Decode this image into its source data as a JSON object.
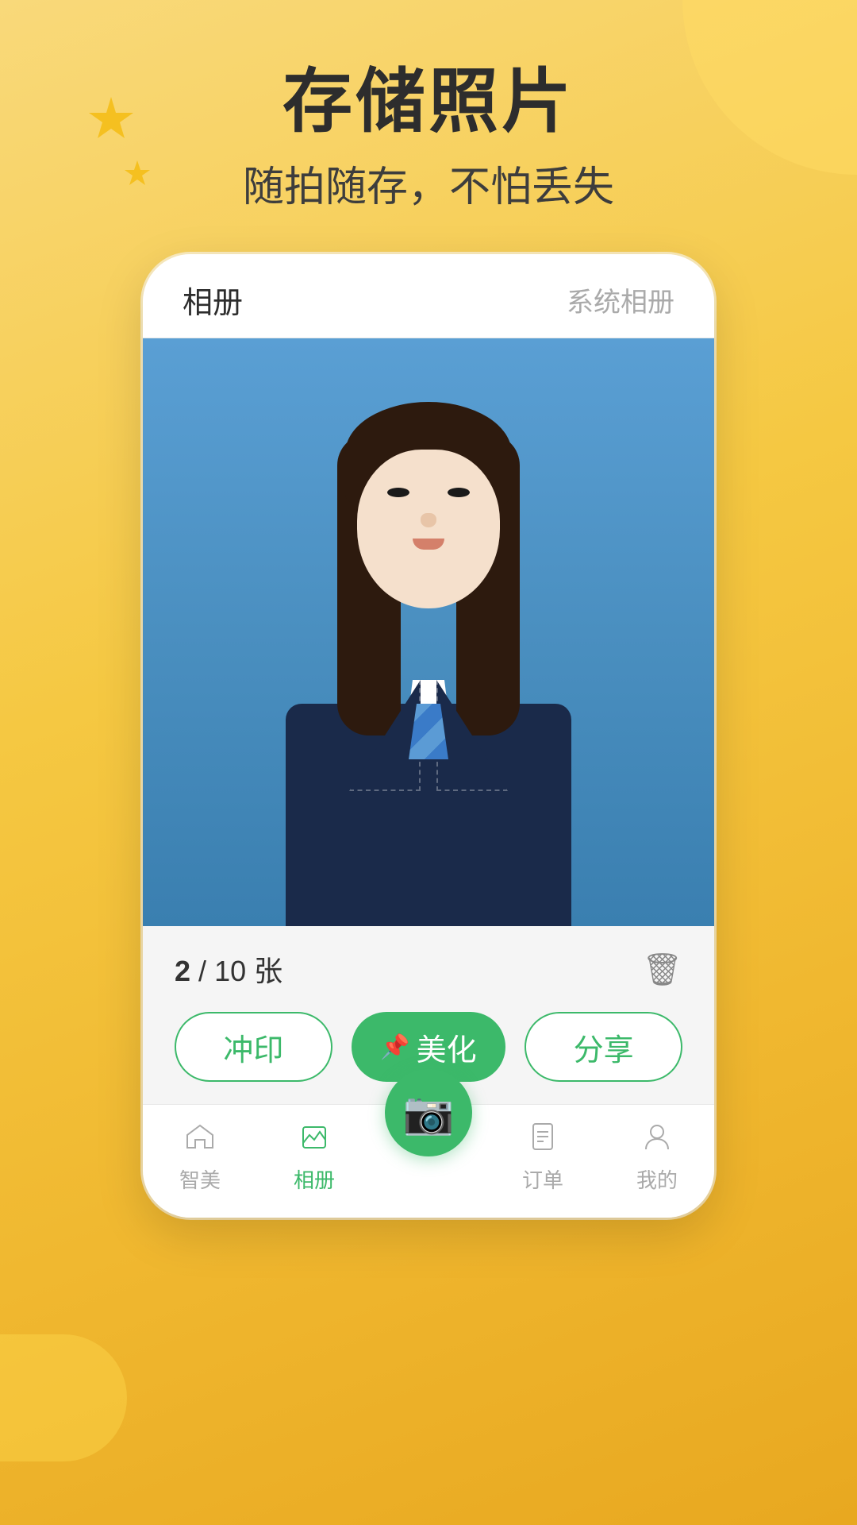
{
  "background": {
    "color_start": "#f9d97a",
    "color_end": "#e8a820"
  },
  "header": {
    "main_title": "存储照片",
    "sub_title": "随拍随存，不怕丢失"
  },
  "phone": {
    "tab_album": "相册",
    "tab_system": "系统相册",
    "counter": {
      "current": "2",
      "separator": "/",
      "total": "10",
      "unit": "张"
    },
    "buttons": {
      "print": "冲印",
      "beautify": "美化",
      "share": "分享",
      "pin_icon": "📌"
    },
    "nav": {
      "items": [
        {
          "label": "智美",
          "icon": "⌂",
          "active": false
        },
        {
          "label": "相册",
          "icon": "▲",
          "active": true
        },
        {
          "label": "camera",
          "icon": "📷",
          "active": false,
          "is_fab": true
        },
        {
          "label": "订单",
          "icon": "≡",
          "active": false
        },
        {
          "label": "我的",
          "icon": "○",
          "active": false
        }
      ]
    }
  },
  "decorations": {
    "star_large": "✦",
    "star_small": "✦"
  }
}
